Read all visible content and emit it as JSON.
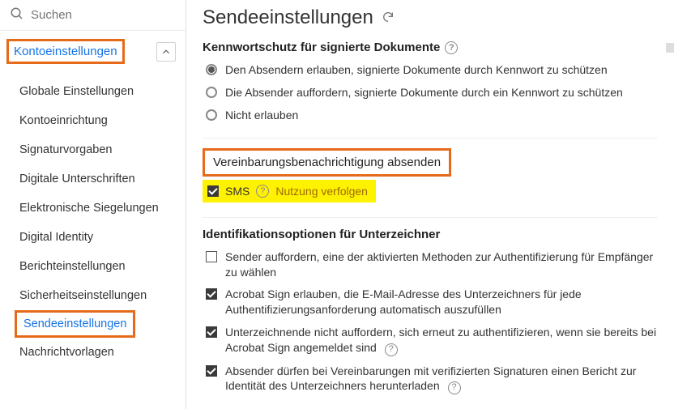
{
  "search": {
    "placeholder": "Suchen"
  },
  "sidebar": {
    "section_label": "Kontoeinstellungen",
    "items": [
      {
        "label": "Globale Einstellungen"
      },
      {
        "label": "Kontoeinrichtung"
      },
      {
        "label": "Signaturvorgaben"
      },
      {
        "label": "Digitale Unterschriften"
      },
      {
        "label": "Elektronische Siegelungen"
      },
      {
        "label": "Digital Identity"
      },
      {
        "label": "Berichteinstellungen"
      },
      {
        "label": "Sicherheitseinstellungen"
      },
      {
        "label": "Sendeeinstellungen"
      },
      {
        "label": "Nachrichtvorlagen"
      }
    ]
  },
  "page": {
    "title": "Sendeeinstellungen"
  },
  "password_protection": {
    "title": "Kennwortschutz für signierte Dokumente",
    "options": [
      {
        "label": "Den Absendern erlauben, signierte Dokumente durch Kennwort zu schützen",
        "selected": true
      },
      {
        "label": "Die Absender auffordern, signierte Dokumente durch ein Kennwort zu schützen",
        "selected": false
      },
      {
        "label": "Nicht erlauben",
        "selected": false
      }
    ]
  },
  "agreement_notification": {
    "title": "Vereinbarungsbenachrichtigung absenden",
    "sms_label": "SMS",
    "track_usage_label": "Nutzung verfolgen"
  },
  "signer_identification": {
    "title": "Identifikationsoptionen für Unterzeichner",
    "options": [
      {
        "label": "Sender auffordern, eine der aktivierten Methoden zur Authentifizierung für Empfänger zu wählen",
        "checked": false,
        "help": false
      },
      {
        "label": "Acrobat Sign erlauben, die E-Mail-Adresse des Unterzeichners für jede Authentifizierungsanforderung automatisch auszufüllen",
        "checked": true,
        "help": false
      },
      {
        "label": "Unterzeichnende nicht auffordern, sich erneut zu authentifizieren, wenn sie bereits bei Acrobat Sign angemeldet sind",
        "checked": true,
        "help": true
      },
      {
        "label": "Absender dürfen bei Vereinbarungen mit verifizierten Signaturen einen Bericht zur Identität des Unterzeichners herunterladen",
        "checked": true,
        "help": true
      }
    ]
  }
}
